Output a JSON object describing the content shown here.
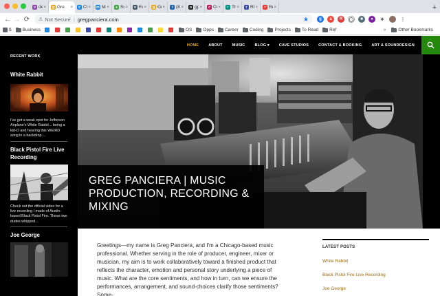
{
  "browser": {
    "tabs": [
      {
        "label": "den",
        "color": "#8e44ad",
        "glyph": "x"
      },
      {
        "label": "Gre",
        "color": "#e7a923",
        "glyph": "g",
        "active": true
      },
      {
        "label": "Cle",
        "color": "#1e88e5",
        "glyph": "c"
      },
      {
        "label": "Mu",
        "color": "#1e88e5",
        "glyph": "m"
      },
      {
        "label": "Sup",
        "color": "#43a047",
        "glyph": "s"
      },
      {
        "label": "Exp",
        "color": "#455a64",
        "glyph": "e"
      },
      {
        "label": "Gre",
        "color": "#e7a923",
        "glyph": "g"
      },
      {
        "label": "(8)",
        "color": "#1565c0",
        "glyph": "i"
      },
      {
        "label": "gpa",
        "color": "#212121",
        "glyph": "o"
      },
      {
        "label": "Cre",
        "color": "#c2185b",
        "glyph": "c"
      },
      {
        "label": "The",
        "color": "#00897b",
        "glyph": "t"
      },
      {
        "label": "REA",
        "color": "#3949ab",
        "glyph": "r"
      },
      {
        "label": "Rea",
        "color": "#e53935",
        "glyph": "r"
      }
    ],
    "address": {
      "security": "Not Secure",
      "url": "gregpanciera.com"
    },
    "bookmarks": [
      {
        "label": "$",
        "kind": "icon",
        "color": "#5f6368"
      },
      {
        "label": "Business",
        "kind": "folder"
      },
      {
        "label": "",
        "kind": "icon",
        "color": "#1e88e5"
      },
      {
        "label": "",
        "kind": "icon",
        "color": "#e53935"
      },
      {
        "label": "",
        "kind": "icon",
        "color": "#43a047"
      },
      {
        "label": "",
        "kind": "icon",
        "color": "#fbc02d"
      },
      {
        "label": "",
        "kind": "icon",
        "color": "#3949ab"
      },
      {
        "label": "",
        "kind": "icon",
        "color": "#e53935"
      },
      {
        "label": "",
        "kind": "icon",
        "color": "#00897b"
      },
      {
        "label": "",
        "kind": "icon",
        "color": "#fb8c00"
      },
      {
        "label": "",
        "kind": "icon",
        "color": "#8e24aa"
      },
      {
        "label": "",
        "kind": "icon",
        "color": "#1e88e5"
      },
      {
        "label": "",
        "kind": "icon",
        "color": "#43a047"
      },
      {
        "label": "",
        "kind": "icon",
        "color": "#fdd835"
      },
      {
        "label": "",
        "kind": "icon",
        "color": "#e53935"
      },
      {
        "label": "OS",
        "kind": "folder"
      },
      {
        "label": "Opps",
        "kind": "folder"
      },
      {
        "label": "Career",
        "kind": "folder"
      },
      {
        "label": "Coding",
        "kind": "folder"
      },
      {
        "label": "Projects",
        "kind": "folder"
      },
      {
        "label": "To Read",
        "kind": "folder"
      },
      {
        "label": "Ref",
        "kind": "folder"
      }
    ],
    "bookmarks_more": "»",
    "other_bookmarks": "Other Bookmarks"
  },
  "site": {
    "nav": [
      "HOME",
      "ABOUT",
      "MUSIC",
      "BLOG ▾",
      "CAVE STUDIOS",
      "CONTACT & BOOKING",
      "ART & SOUNDDESIGN"
    ],
    "accent": "#e7a923",
    "search_bg": "#24890d",
    "sidebar": {
      "widget_title": "RECENT WORK",
      "posts": [
        {
          "title": "White Rabbit",
          "excerpt": "I've got a weak spot for Jefferson Airplane's White Rabbit... being a kid-O and hearing this WEIRD song in a backdrop…"
        },
        {
          "title": "Black Pistol Fire Live Recording",
          "excerpt": "Check out the official video for a live recording I made of Austin-based Black Pistol Fire. These two dudes whipped…"
        },
        {
          "title": "Joe George",
          "excerpt": ""
        }
      ]
    },
    "hero_title": "GREG PANCIERA | MUSIC PRODUCTION, RECORDING & MIXING",
    "intro": "Greetings—my name is Greg Panciera, and I'm a Chicago-based music professional. Whether serving in the role of producer, engineer, mixer or musician, my aim is to work collaboratively toward a finished product that reflects the character, emotion and personal story underlying a piece of music. What are the core sentiments, and how in turn, can we ensure the performances, arrangement, and sound-choices clarify those sentiments? Some-",
    "latest": {
      "title": "LATEST POSTS",
      "items": [
        "White Rabbit",
        "Black Pistol Fire Live Recording",
        "Joe George"
      ]
    }
  }
}
